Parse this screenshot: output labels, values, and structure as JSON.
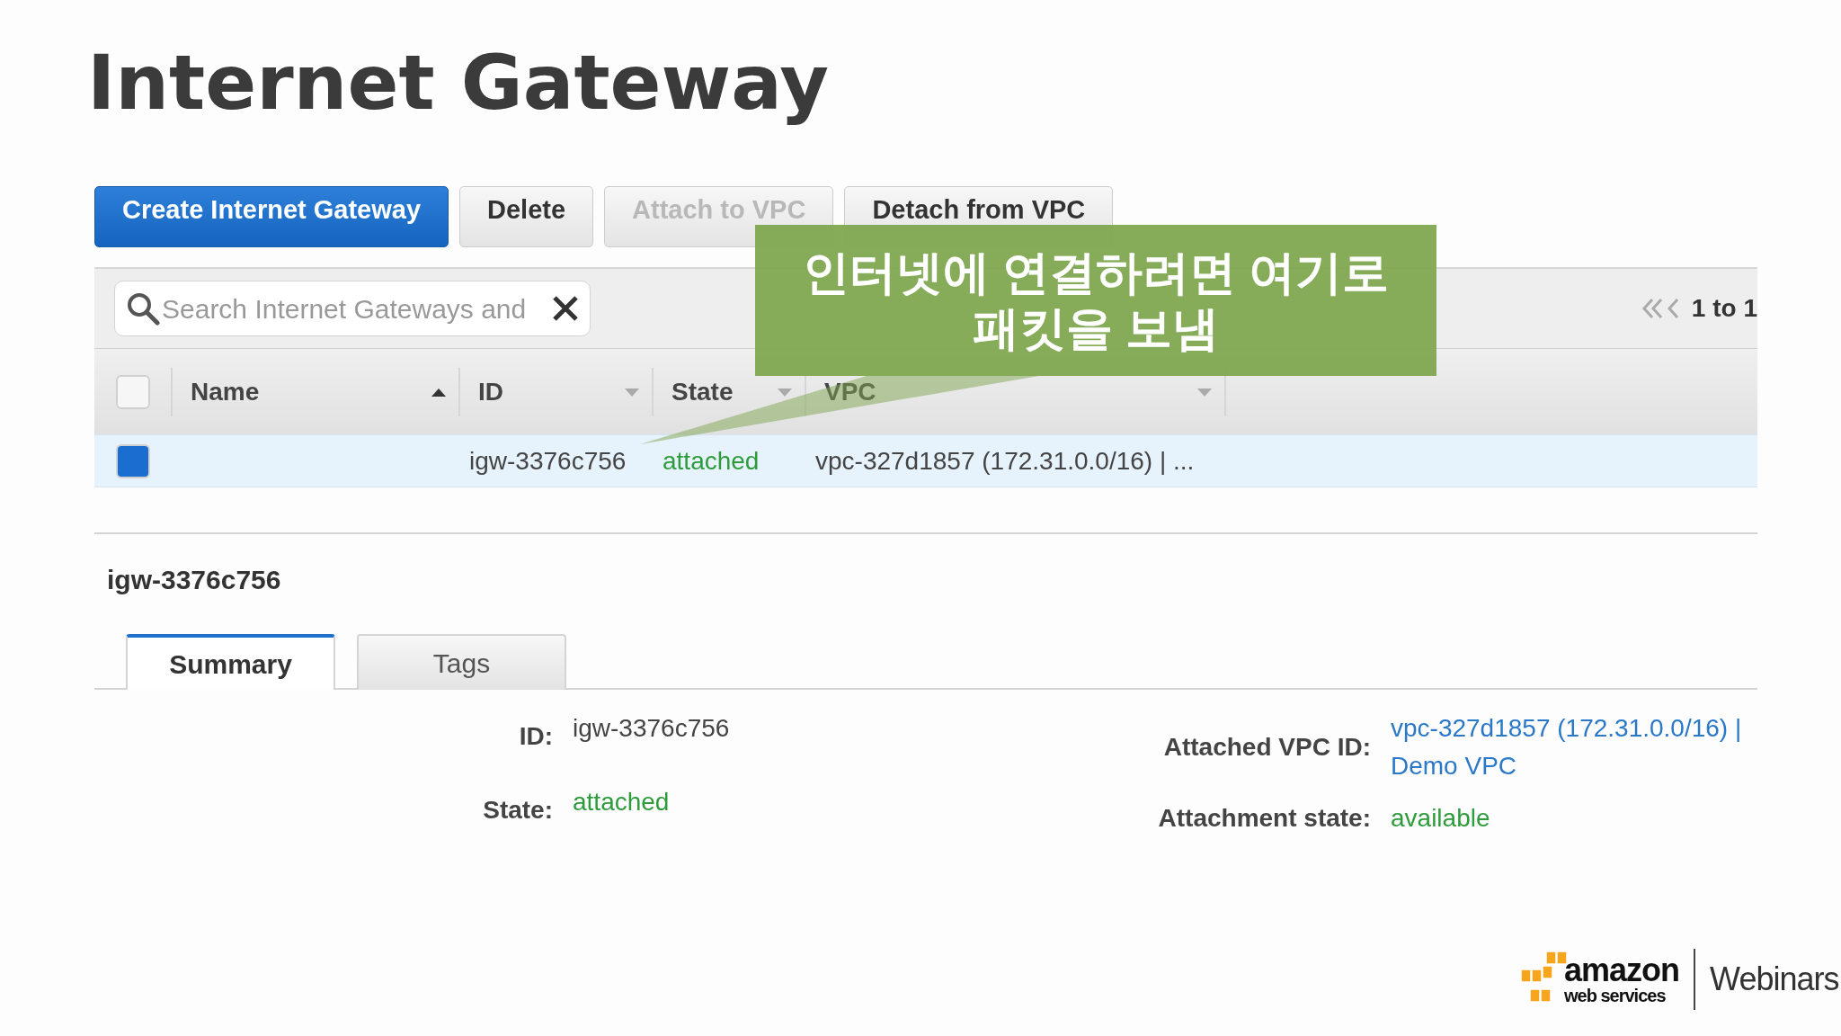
{
  "slide_title": "Internet Gateway",
  "toolbar": [
    {
      "label": "Create Internet Gateway",
      "kind": "primary",
      "disabled": false
    },
    {
      "label": "Delete",
      "kind": "default",
      "disabled": false
    },
    {
      "label": "Attach to VPC",
      "kind": "default",
      "disabled": true
    },
    {
      "label": "Detach from VPC",
      "kind": "default",
      "disabled": false
    }
  ],
  "search": {
    "placeholder": "Search Internet Gateways and"
  },
  "pagination": {
    "text": "1 to 1"
  },
  "table": {
    "select_all": {
      "checked": false
    },
    "columns": [
      {
        "label": "Name",
        "sorted": true
      },
      {
        "label": "ID",
        "sorted": false
      },
      {
        "label": "State",
        "sorted": false
      },
      {
        "label": "VPC",
        "sorted": false
      }
    ],
    "rows": [
      {
        "selected": true,
        "id": "igw-3376c756",
        "state": "attached",
        "vpc": "vpc-327d1857 (172.31.0.0/16) | ..."
      }
    ]
  },
  "detail": {
    "title": "igw-3376c756",
    "tabs": [
      {
        "label": "Summary",
        "selected": true
      },
      {
        "label": "Tags",
        "selected": false
      }
    ],
    "left_fields": [
      {
        "label": "ID:",
        "value": "igw-3376c756",
        "kind": "text"
      },
      {
        "label": "State:",
        "value": "attached",
        "kind": "status"
      }
    ],
    "right_fields": [
      {
        "label": "Attached VPC ID:",
        "value": "vpc-327d1857 (172.31.0.0/16) | Demo VPC",
        "kind": "link"
      },
      {
        "label": "Attachment state:",
        "value": "available",
        "kind": "status"
      }
    ]
  },
  "callout": {
    "text": "인터넷에 연결하려면 여기로\n패킷을 보냄"
  },
  "logo": {
    "brand": "amazon",
    "subbrand": "web services",
    "label": "Webinars"
  }
}
